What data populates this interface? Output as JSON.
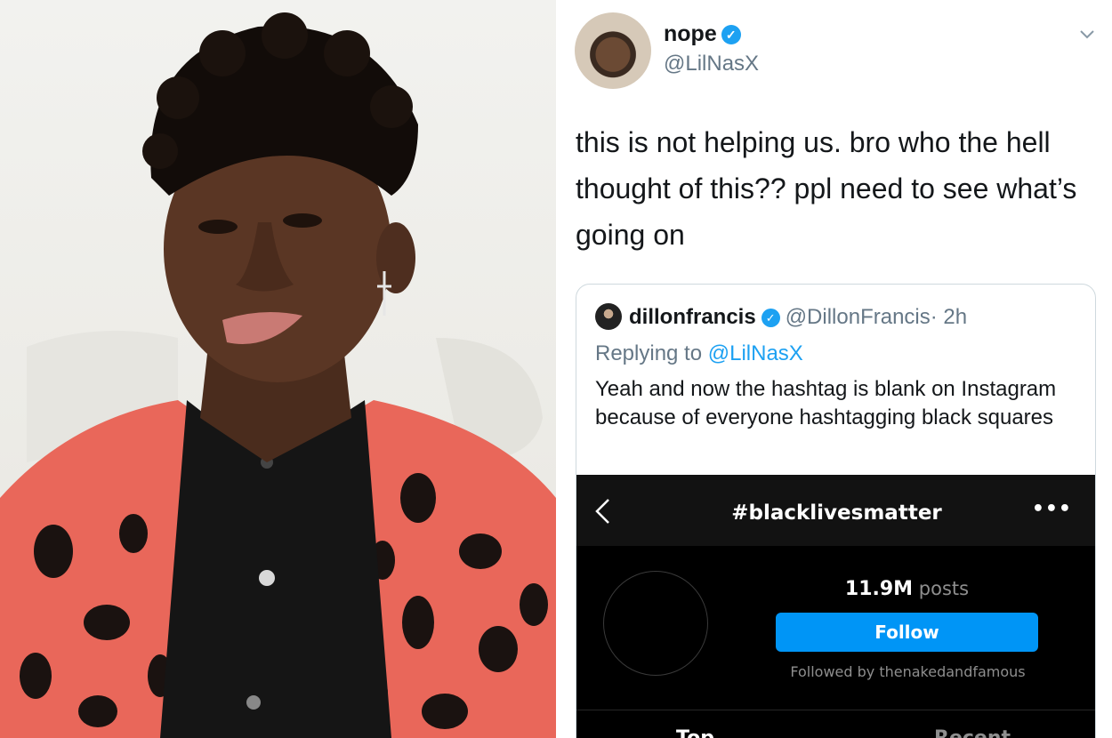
{
  "tweet": {
    "author_name": "nope",
    "author_handle": "@LilNasX",
    "text": "this is not helping us. bro who the hell thought of this?? ppl need to see what’s going on",
    "verified_glyph": "✓"
  },
  "quoted_tweet": {
    "author_name": "dillonfrancis",
    "author_handle": "@DillonFrancis",
    "time": "· 2h",
    "replying_prefix": "Replying to",
    "replying_to": "@LilNasX",
    "text": "Yeah and now the hashtag is blank on Instagram because of everyone hashtagging black squares"
  },
  "instagram": {
    "back_icon": "chevron-left-icon",
    "hashtag": "#blacklivesmatter",
    "more_label": "•••",
    "post_count": "11.9M",
    "post_count_suffix": "posts",
    "follow_label": "Follow",
    "followed_by": "Followed by thenakedandfamous",
    "tab_top": "Top",
    "tab_recent": "Recent"
  },
  "colors": {
    "twitter_blue": "#1da1f2",
    "instagram_blue": "#0095f6",
    "text_primary": "#14171a",
    "text_secondary": "#657786"
  }
}
